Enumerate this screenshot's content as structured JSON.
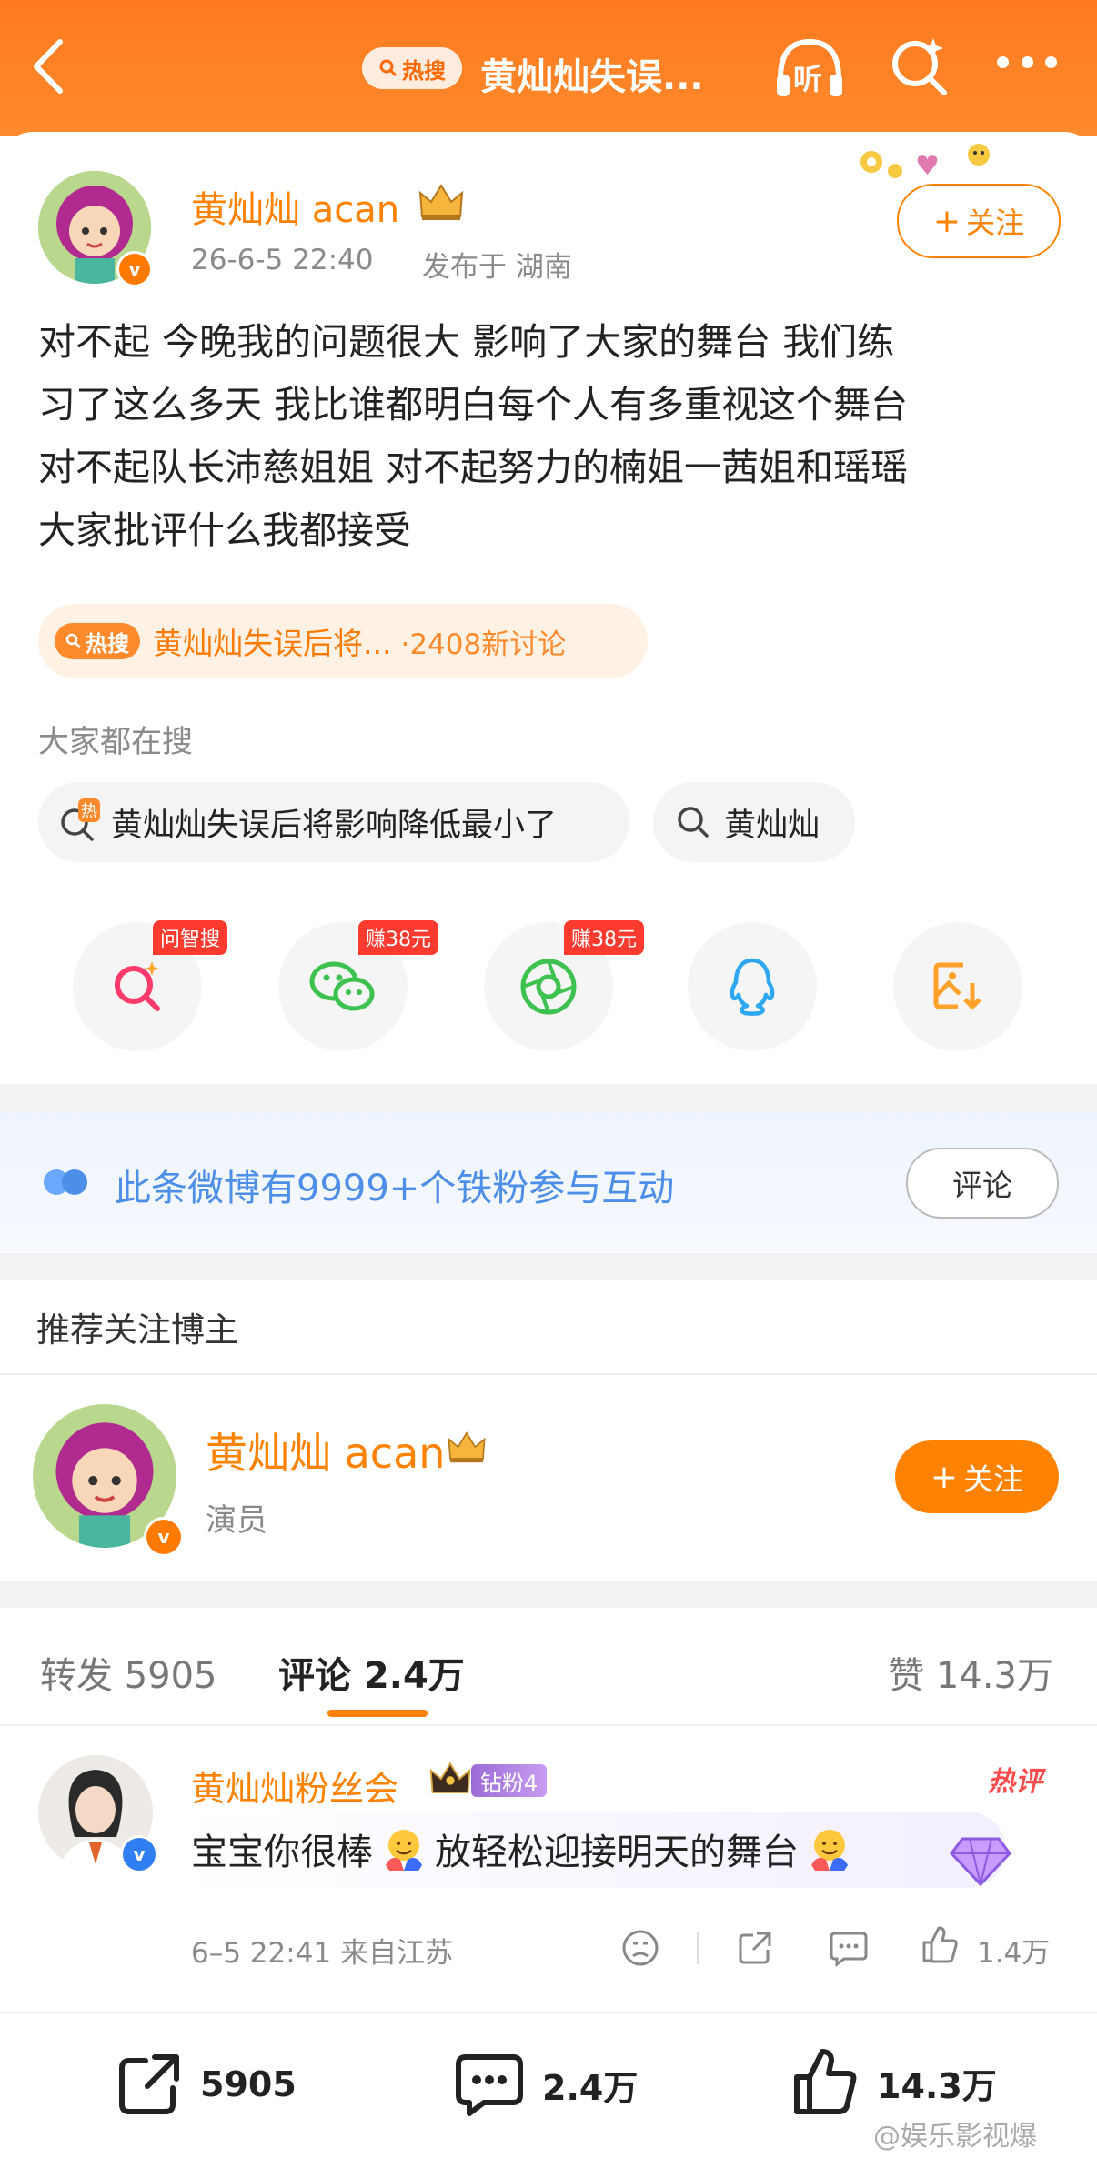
{
  "header": {
    "hot_label": "热搜",
    "title": "黄灿灿失误...",
    "back_icon": "back-arrow-icon",
    "listen_label": "听",
    "search_icon": "search-sparkle-icon",
    "more_icon": "more-dots-icon"
  },
  "post": {
    "author_name": "黄灿灿 acan",
    "timestamp": "26-6-5 22:40",
    "location": "发布于 湖南",
    "follow_label": "关注",
    "text_lines": [
      "对不起 今晚我的问题很大 影响了大家的舞台 我们练",
      "习了这么多天 我比谁都明白每个人有多重视这个舞台",
      "对不起队长沛慈姐姐 对不起努力的楠姐一茜姐和瑶瑶",
      "大家批评什么我都接受"
    ],
    "hot_tag": {
      "badge": "热搜",
      "topic": "黄灿灿失误后将...",
      "count": "·2408新讨论"
    }
  },
  "searches": {
    "label": "大家都在搜",
    "hot_mark": "热",
    "items": [
      "黄灿灿失误后将影响降低最小了",
      "黄灿灿"
    ]
  },
  "share": {
    "items": [
      {
        "icon": "ai-search-icon",
        "badge": "问智搜"
      },
      {
        "icon": "wechat-icon",
        "badge": "赚38元"
      },
      {
        "icon": "moments-icon",
        "badge": "赚38元"
      },
      {
        "icon": "qq-icon",
        "badge": ""
      },
      {
        "icon": "save-image-icon",
        "badge": ""
      }
    ]
  },
  "fans_banner": {
    "text": "此条微博有9999+个铁粉参与互动",
    "button": "评论"
  },
  "recommend": {
    "title": "推荐关注博主",
    "name": "黄灿灿 acan",
    "role": "演员",
    "follow_label": "关注"
  },
  "tabs": {
    "repost": "转发 5905",
    "comment": "评论 2.4万",
    "like": "赞 14.3万"
  },
  "comment": {
    "user": "黄灿灿粉丝会",
    "fan_badge": "钻粉4",
    "hot_label": "热评",
    "text_a": "宝宝你很棒",
    "text_b": "放轻松迎接明天的舞台",
    "meta": "6–5 22:41 来自江苏",
    "like_count": "1.4万"
  },
  "bottom": {
    "repost": "5905",
    "comment": "2.4万",
    "like": "14.3万",
    "watermark": "@娱乐影视爆"
  },
  "colors": {
    "brand_orange": "#ff8200",
    "header_orange": "#ff7a1f",
    "link_blue": "#4d8ee8"
  }
}
